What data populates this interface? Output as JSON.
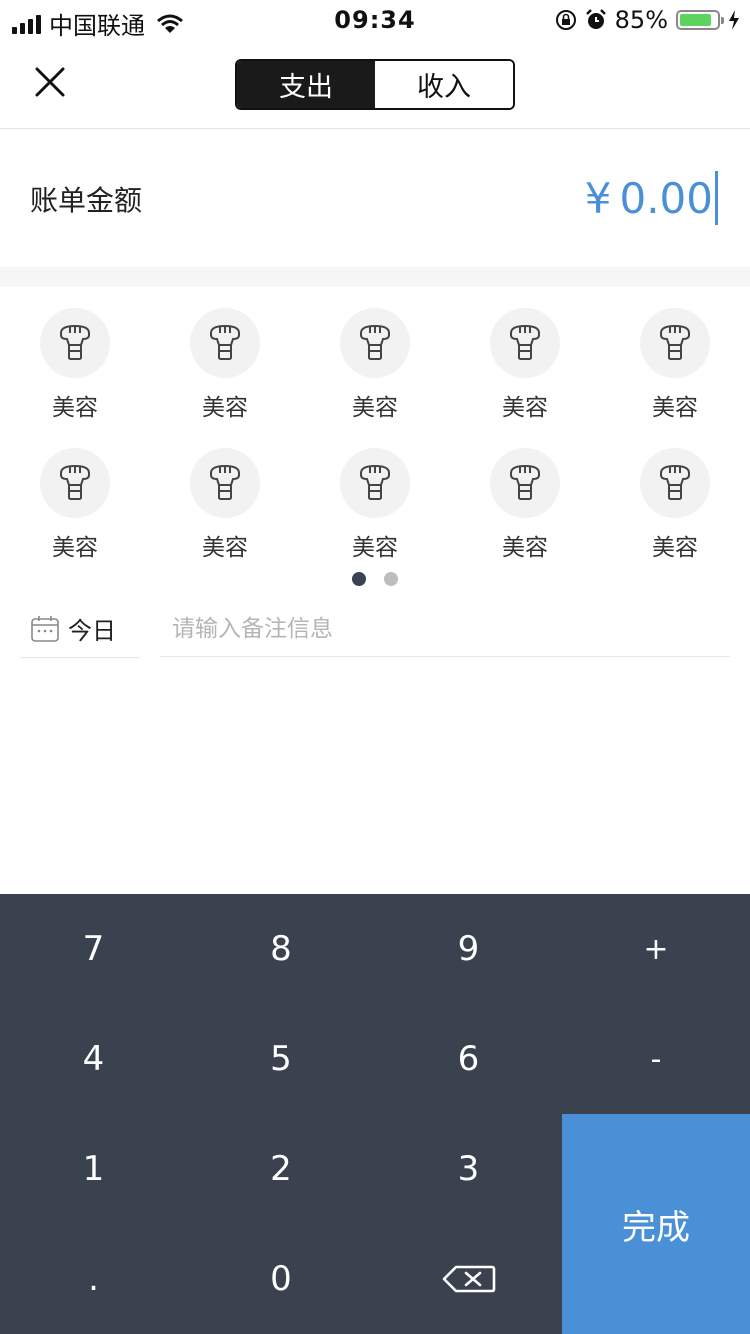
{
  "status": {
    "carrier": "中国联通",
    "time": "09:34",
    "battery": "85%",
    "battery_level": 0.85
  },
  "header": {
    "tabs": [
      "支出",
      "收入"
    ],
    "active_tab": 0
  },
  "amount": {
    "label": "账单金额",
    "currency": "¥",
    "value": "0.00",
    "accent_color": "#4a90d6"
  },
  "categories": [
    {
      "label": "美容",
      "icon": "beauty-brush-icon"
    },
    {
      "label": "美容",
      "icon": "beauty-brush-icon"
    },
    {
      "label": "美容",
      "icon": "beauty-brush-icon"
    },
    {
      "label": "美容",
      "icon": "beauty-brush-icon"
    },
    {
      "label": "美容",
      "icon": "beauty-brush-icon"
    },
    {
      "label": "美容",
      "icon": "beauty-brush-icon"
    },
    {
      "label": "美容",
      "icon": "beauty-brush-icon"
    },
    {
      "label": "美容",
      "icon": "beauty-brush-icon"
    },
    {
      "label": "美容",
      "icon": "beauty-brush-icon"
    },
    {
      "label": "美容",
      "icon": "beauty-brush-icon"
    }
  ],
  "pager": {
    "pages": 2,
    "current": 1
  },
  "date": {
    "label": "今日"
  },
  "memo": {
    "placeholder": "请输入备注信息",
    "value": ""
  },
  "keypad": {
    "keys": [
      [
        "7",
        "8",
        "9",
        "+"
      ],
      [
        "4",
        "5",
        "6",
        "-"
      ],
      [
        "1",
        "2",
        "3"
      ],
      [
        ".",
        "0",
        "⌫"
      ]
    ],
    "done": "完成",
    "background": "#3a4250",
    "done_color": "#4a90d6"
  }
}
